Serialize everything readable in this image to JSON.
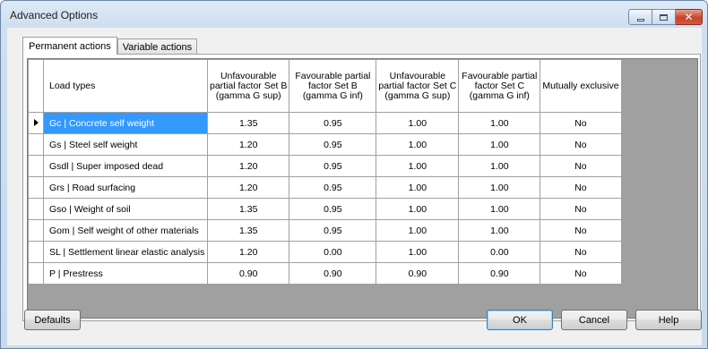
{
  "window": {
    "title": "Advanced Options",
    "controls": {
      "minimize_glyph": "minimize-icon",
      "maximize_glyph": "maximize-icon",
      "close_glyph": "✕"
    }
  },
  "tabs": [
    {
      "label": "Permanent actions",
      "active": true
    },
    {
      "label": "Variable actions",
      "active": false
    }
  ],
  "table": {
    "columns": [
      {
        "label": "Load types",
        "lines": [
          "Load types"
        ]
      },
      {
        "label": "Unfavourable partial factor Set B (gamma G sup)",
        "lines": [
          "Unfavourable",
          "partial factor Set B",
          "(gamma G sup)"
        ]
      },
      {
        "label": "Favourable partial factor Set B (gamma G inf)",
        "lines": [
          "Favourable partial",
          "factor Set B",
          "(gamma G inf)"
        ]
      },
      {
        "label": "Unfavourable partial factor Set C (gamma G sup)",
        "lines": [
          "Unfavourable",
          "partial factor Set C",
          "(gamma G sup)"
        ]
      },
      {
        "label": "Favourable partial factor Set C (gamma G inf)",
        "lines": [
          "Favourable partial",
          "factor Set C",
          "(gamma G inf)"
        ]
      },
      {
        "label": "Mutually exclusive",
        "lines": [
          "Mutually exclusive"
        ]
      }
    ],
    "rows": [
      {
        "load_type": "Gc | Concrete self weight",
        "b_sup": "1.35",
        "b_inf": "0.95",
        "c_sup": "1.00",
        "c_inf": "1.00",
        "exclusive": "No",
        "selected": true
      },
      {
        "load_type": "Gs | Steel self weight",
        "b_sup": "1.20",
        "b_inf": "0.95",
        "c_sup": "1.00",
        "c_inf": "1.00",
        "exclusive": "No"
      },
      {
        "load_type": "Gsdl | Super imposed dead",
        "b_sup": "1.20",
        "b_inf": "0.95",
        "c_sup": "1.00",
        "c_inf": "1.00",
        "exclusive": "No"
      },
      {
        "load_type": "Grs | Road surfacing",
        "b_sup": "1.20",
        "b_inf": "0.95",
        "c_sup": "1.00",
        "c_inf": "1.00",
        "exclusive": "No"
      },
      {
        "load_type": "Gso | Weight of soil",
        "b_sup": "1.35",
        "b_inf": "0.95",
        "c_sup": "1.00",
        "c_inf": "1.00",
        "exclusive": "No"
      },
      {
        "load_type": "Gom | Self weight of other materials",
        "b_sup": "1.35",
        "b_inf": "0.95",
        "c_sup": "1.00",
        "c_inf": "1.00",
        "exclusive": "No"
      },
      {
        "load_type": "SL | Settlement linear elastic analysis",
        "b_sup": "1.20",
        "b_inf": "0.00",
        "c_sup": "1.00",
        "c_inf": "0.00",
        "exclusive": "No"
      },
      {
        "load_type": "P | Prestress",
        "b_sup": "0.90",
        "b_inf": "0.90",
        "c_sup": "0.90",
        "c_inf": "0.90",
        "exclusive": "No"
      }
    ]
  },
  "buttons": {
    "defaults": "Defaults",
    "ok": "OK",
    "cancel": "Cancel",
    "help": "Help"
  },
  "colors": {
    "selection": "#3399ff",
    "grid_background": "#a0a0a0",
    "title_bar": "#dde9f6"
  }
}
